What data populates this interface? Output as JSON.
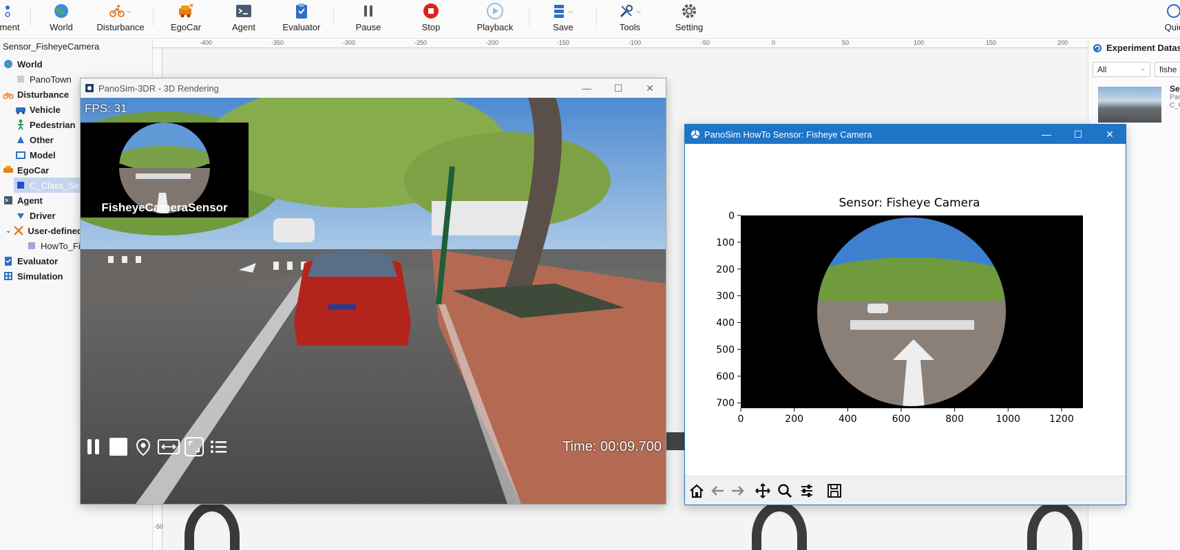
{
  "toolbar": {
    "items": [
      {
        "label": "ment",
        "icon": "experiment-icon"
      },
      {
        "label": "World",
        "icon": "globe-icon"
      },
      {
        "label": "Disturbance",
        "icon": "bicycle-icon"
      },
      {
        "label": "EgoCar",
        "icon": "car-icon"
      },
      {
        "label": "Agent",
        "icon": "terminal-icon"
      },
      {
        "label": "Evaluator",
        "icon": "clipboard-icon"
      },
      {
        "label": "Pause",
        "icon": "pause-icon"
      },
      {
        "label": "Stop",
        "icon": "stop-icon"
      },
      {
        "label": "Playback",
        "icon": "playback-icon"
      },
      {
        "label": "Save",
        "icon": "save-icon"
      },
      {
        "label": "Tools",
        "icon": "tools-icon"
      },
      {
        "label": "Setting",
        "icon": "gear-icon"
      },
      {
        "label": "Quic",
        "icon": "quick-icon"
      }
    ]
  },
  "tree": {
    "title": "Sensor_FisheyeCamera",
    "nodes": [
      {
        "label": "World"
      },
      {
        "label": "PanoTown"
      },
      {
        "label": "Disturbance"
      },
      {
        "label": "Vehicle"
      },
      {
        "label": "Pedestrian"
      },
      {
        "label": "Other"
      },
      {
        "label": "Model"
      },
      {
        "label": "EgoCar"
      },
      {
        "label": "C_Class_Sedan"
      },
      {
        "label": "Agent"
      },
      {
        "label": "Driver"
      },
      {
        "label": "User-defined"
      },
      {
        "label": "HowTo_Fis"
      },
      {
        "label": "Evaluator"
      },
      {
        "label": "Simulation"
      }
    ]
  },
  "ruler": {
    "x_ticks": [
      "-400",
      "-350",
      "-300",
      "-250",
      "-200",
      "-150",
      "-100",
      "-50",
      "0",
      "50",
      "100",
      "150",
      "200"
    ],
    "y_tick": "-50"
  },
  "right_panel": {
    "title": "Experiment Datas",
    "filter_value": "All",
    "search_value": "fishe",
    "card_title": "Se",
    "card_line1": "Pan",
    "card_line2": "C_C"
  },
  "render_window": {
    "title": "PanoSim-3DR - 3D Rendering",
    "fps": "FPS: 31",
    "sensor_label": "FisheyeCameraSensor",
    "time": "Time: 00:09.700"
  },
  "plot_window": {
    "title": "PanoSim HowTo Sensor: Fisheye Camera"
  },
  "chart_data": {
    "type": "image",
    "title": "Sensor: Fisheye Camera",
    "xlabel": "",
    "ylabel": "",
    "xlim": [
      0,
      1280
    ],
    "ylim": [
      720,
      0
    ],
    "x_ticks": [
      0,
      200,
      400,
      600,
      800,
      1000,
      1200
    ],
    "y_ticks": [
      0,
      100,
      200,
      300,
      400,
      500,
      600,
      700
    ],
    "grid": false
  }
}
